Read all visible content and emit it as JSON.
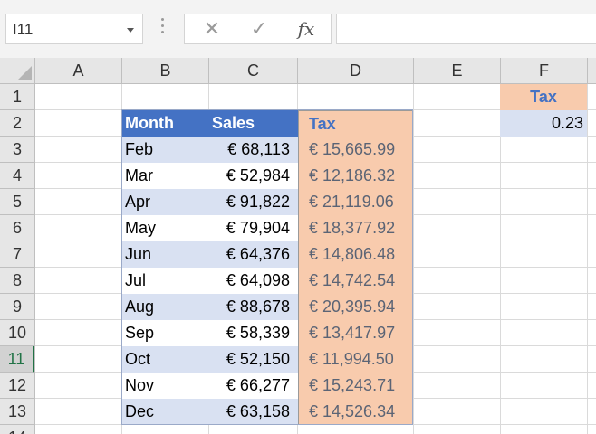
{
  "formula_bar": {
    "name_box": "I11",
    "cancel_glyph": "✕",
    "enter_glyph": "✓",
    "fx_label": "fx",
    "formula": ""
  },
  "columns": [
    "A",
    "B",
    "C",
    "D",
    "E",
    "F"
  ],
  "rows": [
    "1",
    "2",
    "3",
    "4",
    "5",
    "6",
    "7",
    "8",
    "9",
    "10",
    "11",
    "12",
    "13",
    "14"
  ],
  "selected_row": "11",
  "table": {
    "headers": {
      "month": "Month",
      "sales": "Sales",
      "tax": "Tax"
    },
    "rows": [
      {
        "month": "Feb",
        "sales": "€ 68,113",
        "tax": "€ 15,665.99"
      },
      {
        "month": "Mar",
        "sales": "€ 52,984",
        "tax": "€ 12,186.32"
      },
      {
        "month": "Apr",
        "sales": "€ 91,822",
        "tax": "€ 21,119.06"
      },
      {
        "month": "May",
        "sales": "€ 79,904",
        "tax": "€ 18,377.92"
      },
      {
        "month": "Jun",
        "sales": "€ 64,376",
        "tax": "€ 14,806.48"
      },
      {
        "month": "Jul",
        "sales": "€ 64,098",
        "tax": "€ 14,742.54"
      },
      {
        "month": "Aug",
        "sales": "€ 88,678",
        "tax": "€ 20,395.94"
      },
      {
        "month": "Sep",
        "sales": "€ 58,339",
        "tax": "€ 13,417.97"
      },
      {
        "month": "Oct",
        "sales": "€ 52,150",
        "tax": "€ 11,994.50"
      },
      {
        "month": "Nov",
        "sales": "€ 66,277",
        "tax": "€ 15,243.71"
      },
      {
        "month": "Dec",
        "sales": "€ 63,158",
        "tax": "€ 14,526.34"
      }
    ]
  },
  "tax_rate": {
    "label": "Tax",
    "value": "0.23"
  },
  "colors": {
    "table_header": "#4472c4",
    "band": "#d9e1f2",
    "tax_fill": "#f8cbad",
    "selection": "#217346"
  }
}
